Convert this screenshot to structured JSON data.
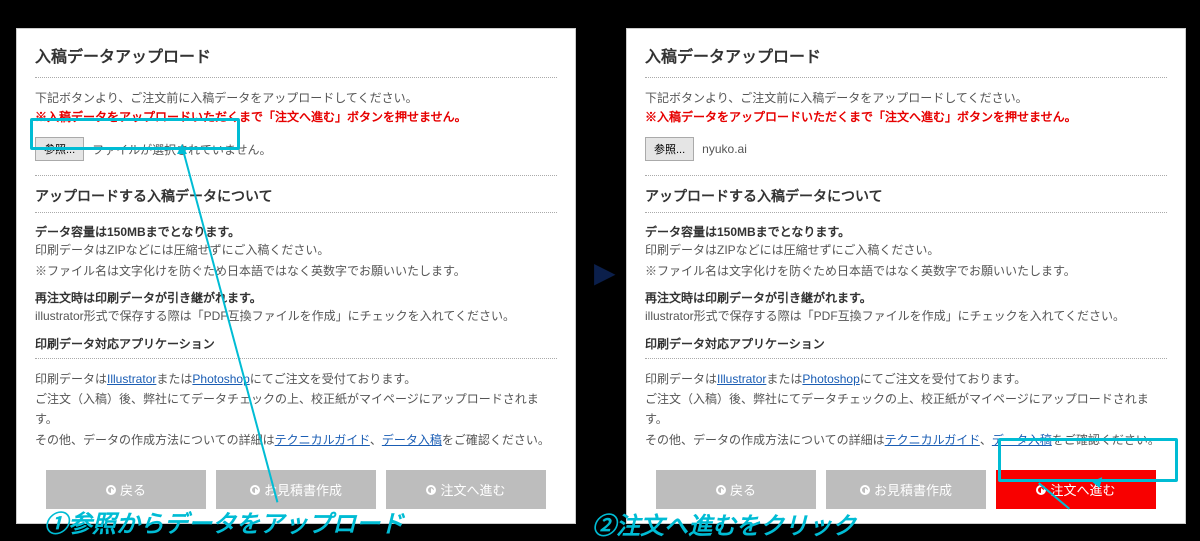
{
  "panel": {
    "title": "入稿データアップロード",
    "desc1": "下記ボタンより、ご注文前に入稿データをアップロードしてください。",
    "warn": "※入稿データをアップロードいただくまで「注文へ進む」ボタンを押せません。",
    "browseLabel": "参照...",
    "fileNone": "ファイルが選択されていません。",
    "fileSelected": "nyuko.ai",
    "sec2Title": "アップロードする入稿データについて",
    "cap1": "データ容量は150MBまでとなります。",
    "cap1a": "印刷データはZIPなどには圧縮せずにご入稿ください。",
    "cap1b": "※ファイル名は文字化けを防ぐため日本語ではなく英数字でお願いいたします。",
    "cap2": "再注文時は印刷データが引き継がれます。",
    "cap2a": "illustrator形式で保存する際は「PDF互換ファイルを作成」にチェックを入れてください。",
    "cap3": "印刷データ対応アプリケーション",
    "app1_pre": "印刷データは",
    "app1_link1": "Illustrator",
    "app1_mid": "または",
    "app1_link2": "Photoshop",
    "app1_post": "にてご注文を受付ております。",
    "app2": "ご注文（入稿）後、弊社にてデータチェックの上、校正紙がマイページにアップロードされます。",
    "app3_pre": "その他、データの作成方法についての詳細は",
    "app3_link1": "テクニカルガイド",
    "app3_mid": "、",
    "app3_link2": "データ入稿",
    "app3_post": "をご確認ください。",
    "btnBack": "戻る",
    "btnQuote": "お見積書作成",
    "btnOrder": "注文へ進む"
  },
  "annotations": {
    "arrow": "▶",
    "cap1": "①参照からデータをアップロード",
    "cap2": "②注文へ進むをクリック"
  }
}
